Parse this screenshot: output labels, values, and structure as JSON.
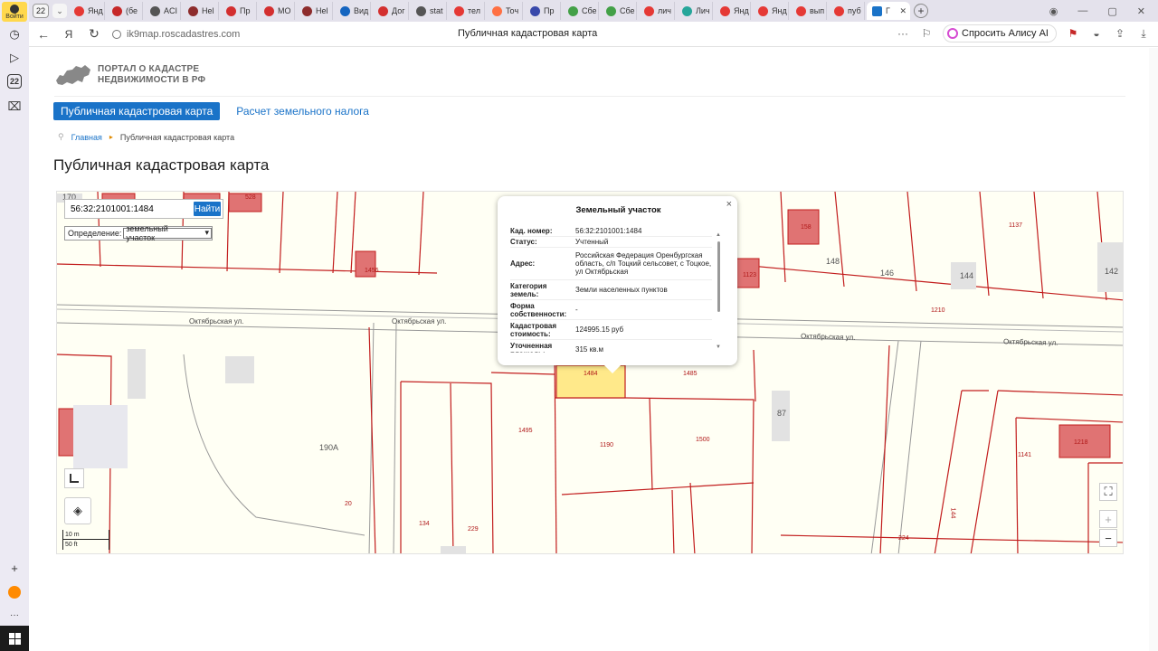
{
  "browser": {
    "profile_label": "Войти",
    "sidebar_badge": "22",
    "tab_counter": "22",
    "tabs": [
      {
        "label": "Янд",
        "color": "#e53935"
      },
      {
        "label": "(бе",
        "color": "#c62828"
      },
      {
        "label": "ACI",
        "color": "#555555"
      },
      {
        "label": "Hel",
        "color": "#8d2c2c"
      },
      {
        "label": "Пр",
        "color": "#d32f2f"
      },
      {
        "label": "МО",
        "color": "#d32f2f"
      },
      {
        "label": "Hel",
        "color": "#8d2c2c"
      },
      {
        "label": "Вид",
        "color": "#1565c0"
      },
      {
        "label": "Дог",
        "color": "#d32f2f"
      },
      {
        "label": "stat",
        "color": "#555555"
      },
      {
        "label": "тел",
        "color": "#e53935"
      },
      {
        "label": "Toч",
        "color": "#ff7043"
      },
      {
        "label": "Пр",
        "color": "#3949ab"
      },
      {
        "label": "Сбе",
        "color": "#43a047"
      },
      {
        "label": "Сбе",
        "color": "#43a047"
      },
      {
        "label": "лич",
        "color": "#e53935"
      },
      {
        "label": "Лич",
        "color": "#26a69a"
      },
      {
        "label": "Янд",
        "color": "#e53935"
      },
      {
        "label": "Янд",
        "color": "#e53935"
      },
      {
        "label": "вып",
        "color": "#e53935"
      },
      {
        "label": "пуб",
        "color": "#e53935"
      }
    ],
    "active_tab": {
      "label": "Г",
      "color": "#1a73c8"
    },
    "url": "ik9map.roscadastres.com",
    "page_title": "Публичная кадастровая карта",
    "alice_label": "Спросить Алису AI"
  },
  "site": {
    "logo_line1": "ПОРТАЛ О КАДАСТРЕ",
    "logo_line2": "НЕДВИЖИМОСТИ В РФ",
    "nav": {
      "active": "Публичная кадастровая карта",
      "other": "Расчет земельного налога"
    },
    "breadcrumb": {
      "home": "Главная",
      "current": "Публичная кадастровая карта"
    },
    "heading": "Публичная кадастровая карта"
  },
  "map": {
    "search_value": "56:32:2101001:1484",
    "search_button": "Найти",
    "definition_label": "Определение:",
    "definition_value": "земельный участок",
    "scale_m": "10 m",
    "scale_ft": "50 ft",
    "parcel_labels": {
      "p170": "170",
      "p528": "528",
      "p1456": "1456",
      "p158": "158",
      "p1137": "1137",
      "p148": "148",
      "p146": "146",
      "p144": "144",
      "p142": "142",
      "p1123": "1123",
      "p1210": "1210",
      "p190a": "190А",
      "p20": "20",
      "p1495": "1495",
      "p1190": "1190",
      "p1500": "1500",
      "p1484": "1484",
      "p1485": "1485",
      "p87": "87",
      "p1141": "1141",
      "p1218": "1218",
      "p134": "134",
      "p229": "229",
      "p224": "224",
      "p144b": "144"
    },
    "streets": [
      "Октябрьская ул.",
      "Октябрьская ул.",
      "Октябрьская ул.",
      "Октябрьская ул."
    ],
    "colors": {
      "parcel_line": "#c21d1d",
      "building": "#e07373",
      "selected": "#ffe98a",
      "road": "#888888"
    }
  },
  "popup": {
    "title": "Земельный участок",
    "rows": [
      {
        "k": "Кад. номер:",
        "v": "56:32:2101001:1484"
      },
      {
        "k": "Статус:",
        "v": "Учтенный"
      },
      {
        "k": "Адрес:",
        "v": "Российская Федерация Оренбургская область, с/п Тоцкий сельсовет, с Тоцкое, ул Октябрьская"
      },
      {
        "k": "Категория земель:",
        "v": "Земли населенных пунктов"
      },
      {
        "k": "Форма собственности:",
        "v": "-"
      },
      {
        "k": "Кадастровая стоимость:",
        "v": "124995.15 руб"
      },
      {
        "k": "Уточненная площадь:",
        "v": "315 кв.м"
      }
    ]
  }
}
